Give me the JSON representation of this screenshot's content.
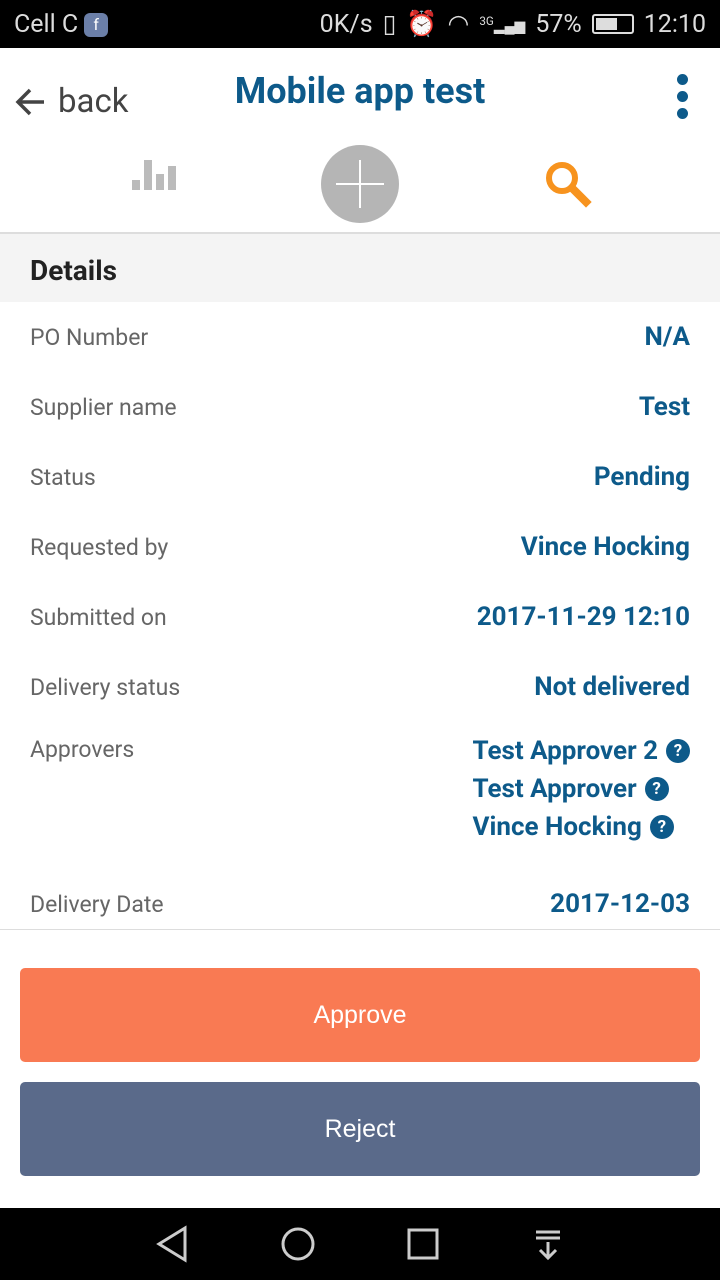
{
  "status_bar": {
    "carrier": "Cell C",
    "speed": "0K/s",
    "network": "3G",
    "battery": "57%",
    "time": "12:10"
  },
  "header": {
    "back_label": "back",
    "title": "Mobile app test"
  },
  "toolbar": {
    "icons": [
      "bar-chart-icon",
      "plus-icon",
      "search-icon"
    ],
    "active_color": "#f7931e"
  },
  "details": {
    "heading": "Details",
    "rows": [
      {
        "label": "PO Number",
        "value": "N/A"
      },
      {
        "label": "Supplier name",
        "value": "Test"
      },
      {
        "label": "Status",
        "value": "Pending"
      },
      {
        "label": "Requested by",
        "value": "Vince Hocking"
      },
      {
        "label": "Submitted on",
        "value": "2017-11-29 12:10"
      },
      {
        "label": "Delivery status",
        "value": "Not delivered"
      }
    ],
    "approvers_label": "Approvers",
    "approvers": [
      "Test Approver 2",
      "Test Approver",
      "Vince Hocking"
    ],
    "help_glyph": "?",
    "delivery_date_label": "Delivery Date",
    "delivery_date": "2017-12-03"
  },
  "actions": {
    "approve": "Approve",
    "reject": "Reject",
    "approve_color": "#f97a53",
    "reject_color": "#5a6a8a"
  },
  "colors": {
    "accent": "#0d5a8a"
  }
}
